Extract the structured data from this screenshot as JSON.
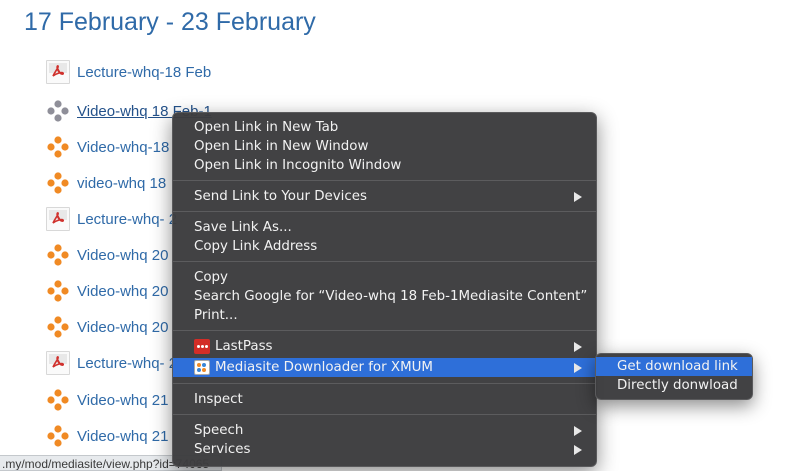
{
  "section": {
    "title": "17 February - 23 February"
  },
  "activities": [
    {
      "label": "Lecture-whq-18 Feb",
      "icon": "pdf-icon"
    },
    {
      "label": "Video-whq 18 Feb-1",
      "icon": "mediasite-icon",
      "selected": true
    },
    {
      "label": "Video-whq-18",
      "icon": "mediasite-icon"
    },
    {
      "label": "video-whq 18",
      "icon": "mediasite-icon"
    },
    {
      "label": "Lecture-whq- 2",
      "icon": "pdf-icon"
    },
    {
      "label": "Video-whq 20",
      "icon": "mediasite-icon"
    },
    {
      "label": "Video-whq 20",
      "icon": "mediasite-icon"
    },
    {
      "label": "Video-whq 20",
      "icon": "mediasite-icon"
    },
    {
      "label": "Lecture-whq- 2",
      "icon": "pdf-icon"
    },
    {
      "label": "Video-whq 21",
      "icon": "mediasite-icon"
    },
    {
      "label": "Video-whq 21",
      "icon": "mediasite-icon"
    }
  ],
  "status_bar": {
    "url": ".my/mod/mediasite/view.php?id=74065"
  },
  "context_menu": {
    "open_new_tab": "Open Link in New Tab",
    "open_new_window": "Open Link in New Window",
    "open_incognito": "Open Link in Incognito Window",
    "send_to_devices": "Send Link to Your Devices",
    "save_link_as": "Save Link As...",
    "copy_link_address": "Copy Link Address",
    "copy": "Copy",
    "search_google": "Search Google for “Video-whq 18 Feb-1Mediasite Content”",
    "print": "Print...",
    "lastpass": "LastPass",
    "mediasite_downloader": "Mediasite Downloader for XMUM",
    "inspect": "Inspect",
    "speech": "Speech",
    "services": "Services"
  },
  "submenu": {
    "get_download_link": "Get download link",
    "directly_download": "Directly donwload"
  },
  "colors": {
    "link": "#2f6aa8",
    "menu_bg": "#3c3c3e",
    "menu_highlight": "#2e6fd9",
    "mediasite_orange": "#f08a24",
    "pdf_red": "#d0312d"
  }
}
